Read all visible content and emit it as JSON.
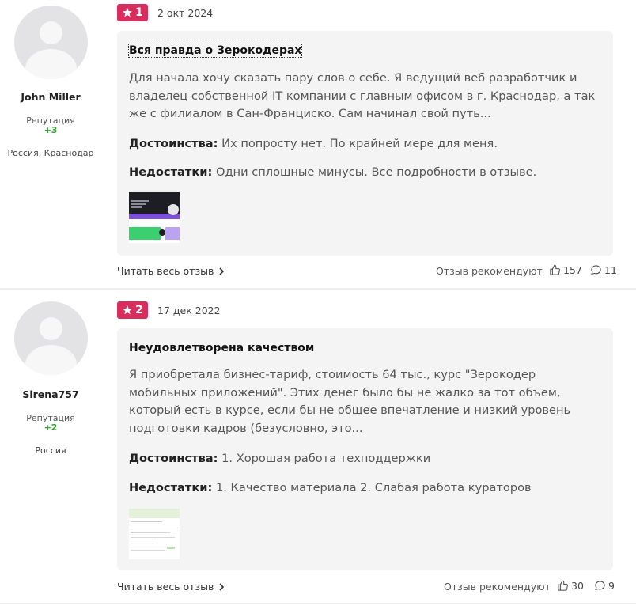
{
  "reviews": [
    {
      "rank": "1",
      "date": "2 окт 2024",
      "author": {
        "name": "John Miller",
        "reputation_label": "Репутация",
        "reputation_value": "+3",
        "location": "Россия, Краснодар"
      },
      "title": "Вся правда о Зерокодерах",
      "text": "Для начала хочу сказать пару слов о себе. Я ведущий веб разработчик и владелец собственной IT компании с главным офисом в г. Краснодар, а так же с филиалом в Сан-Франциско. Сам начинал свой путь...",
      "pros_label": "Достоинства:",
      "pros": "Их попросту нет. По крайней мере для меня.",
      "cons_label": "Недостатки:",
      "cons": "Одни сплошные минусы. Все подробности в отзыве.",
      "read_more": "Читать весь отзыв",
      "recommend_label": "Отзыв рекомендуют",
      "likes": "157",
      "comments": "11"
    },
    {
      "rank": "2",
      "date": "17 дек 2022",
      "author": {
        "name": "Sirena757",
        "reputation_label": "Репутация",
        "reputation_value": "+2",
        "location": "Россия"
      },
      "title": "Неудовлетворена качеством",
      "text": "Я приобретала бизнес-тариф, стоимость 64 тыс., курс \"Зерокодер мобильных приложений\". Этих денег было бы не жалко за тот объем, который есть в курсе, если бы не общее впечатление и низкий уровень подготовки кадров (безусловно, это...",
      "pros_label": "Достоинства:",
      "pros": "1. Хорошая работа техподдержки",
      "cons_label": "Недостатки:",
      "cons": "1. Качество материала 2. Слабая работа кураторов",
      "read_more": "Читать весь отзыв",
      "recommend_label": "Отзыв рекомендуют",
      "likes": "30",
      "comments": "9"
    }
  ],
  "colors": {
    "badge": "#d92e5d",
    "reputation": "#2aa02a",
    "card": "#f4f4f4"
  },
  "icons": [
    "star-icon",
    "chevron-right-icon",
    "thumbs-up-icon",
    "comment-icon",
    "avatar-placeholder-icon"
  ]
}
